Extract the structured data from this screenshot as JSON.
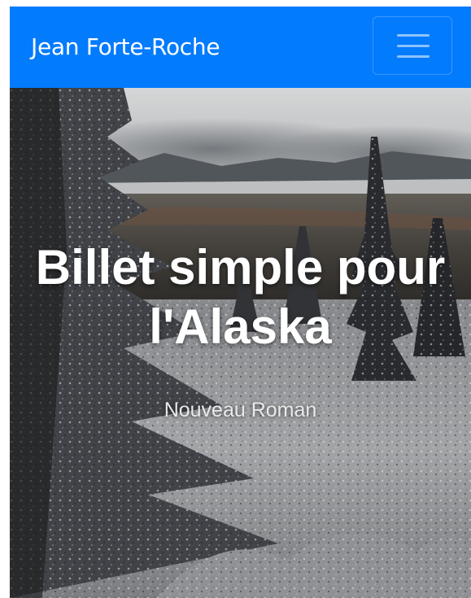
{
  "navbar": {
    "brand": "Jean Forte-Roche",
    "menu_toggle_icon": "hamburger-icon",
    "background_color": "#037bfd"
  },
  "hero": {
    "title": "Billet simple pour l'Alaska",
    "subtitle": "Nouveau Roman",
    "background_image": "frosted-alaska-forest-landscape"
  }
}
